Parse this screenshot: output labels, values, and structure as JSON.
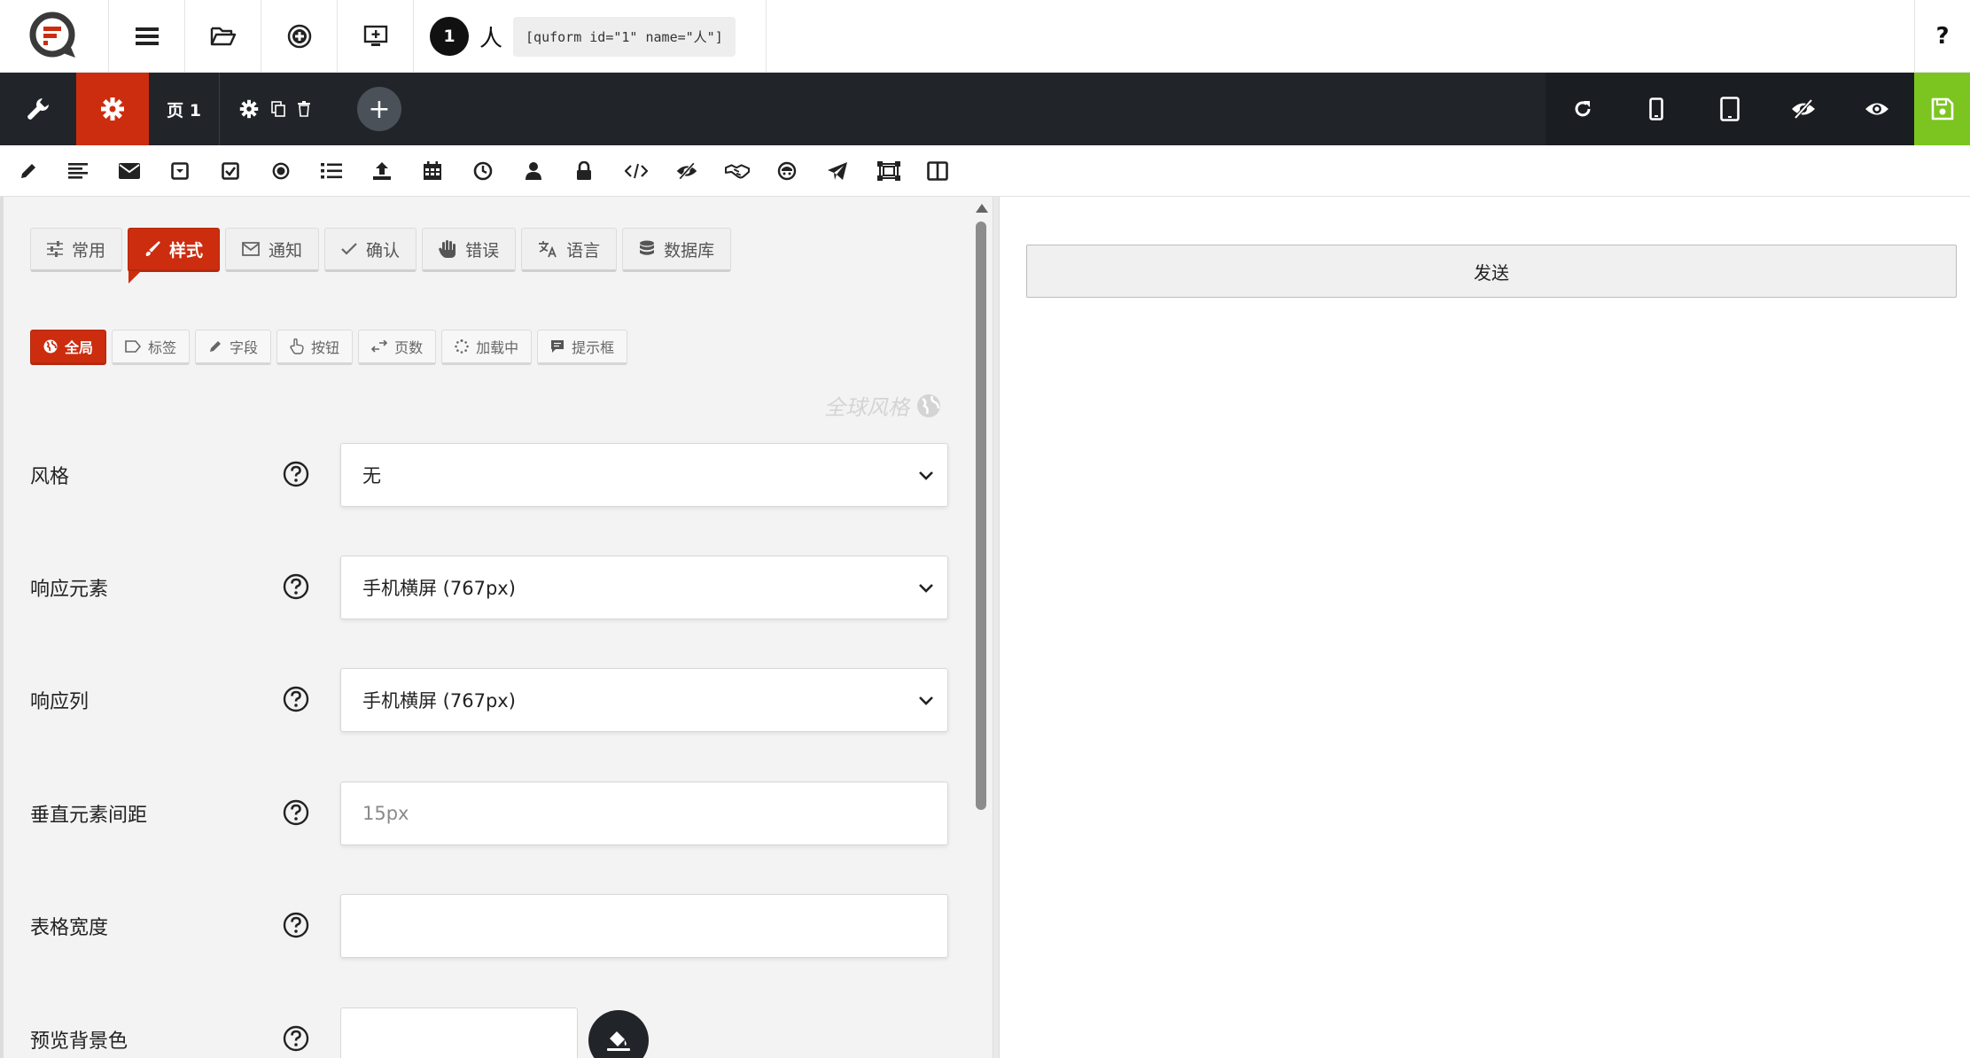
{
  "topbar": {
    "form_number": "1",
    "form_name": "人",
    "shortcode": "[quform id=\"1\" name=\"人\"]",
    "help_label": "?"
  },
  "darkbar": {
    "page_label": "页 1",
    "add_page_label": "+"
  },
  "tabs": [
    {
      "label": "常用",
      "icon": "sliders-icon"
    },
    {
      "label": "样式",
      "icon": "paintbrush-icon",
      "active": true
    },
    {
      "label": "通知",
      "icon": "envelope-icon"
    },
    {
      "label": "确认",
      "icon": "check-icon"
    },
    {
      "label": "错误",
      "icon": "hand-icon"
    },
    {
      "label": "语言",
      "icon": "translate-icon"
    },
    {
      "label": "数据库",
      "icon": "database-icon"
    }
  ],
  "subtabs": [
    {
      "label": "全局",
      "icon": "globe-icon",
      "active": true
    },
    {
      "label": "标签",
      "icon": "tag-icon"
    },
    {
      "label": "字段",
      "icon": "pencil-icon"
    },
    {
      "label": "按钮",
      "icon": "pointer-icon"
    },
    {
      "label": "页数",
      "icon": "arrows-icon"
    },
    {
      "label": "加载中",
      "icon": "spinner-icon"
    },
    {
      "label": "提示框",
      "icon": "comment-icon"
    }
  ],
  "section_watermark": "全球风格",
  "settings": {
    "style": {
      "label": "风格",
      "value": "无"
    },
    "responsive_elements": {
      "label": "响应元素",
      "value": "手机横屏 (767px)"
    },
    "responsive_columns": {
      "label": "响应列",
      "value": "手机横屏 (767px)"
    },
    "vertical_spacing": {
      "label": "垂直元素间距",
      "placeholder": "15px"
    },
    "form_width": {
      "label": "表格宽度",
      "value": ""
    },
    "preview_bg": {
      "label": "预览背景色",
      "value": ""
    }
  },
  "preview": {
    "submit_label": "发送"
  },
  "colors": {
    "accent_red": "#cc2d0f",
    "save_green": "#7cc520",
    "dark_bar": "#212529"
  }
}
